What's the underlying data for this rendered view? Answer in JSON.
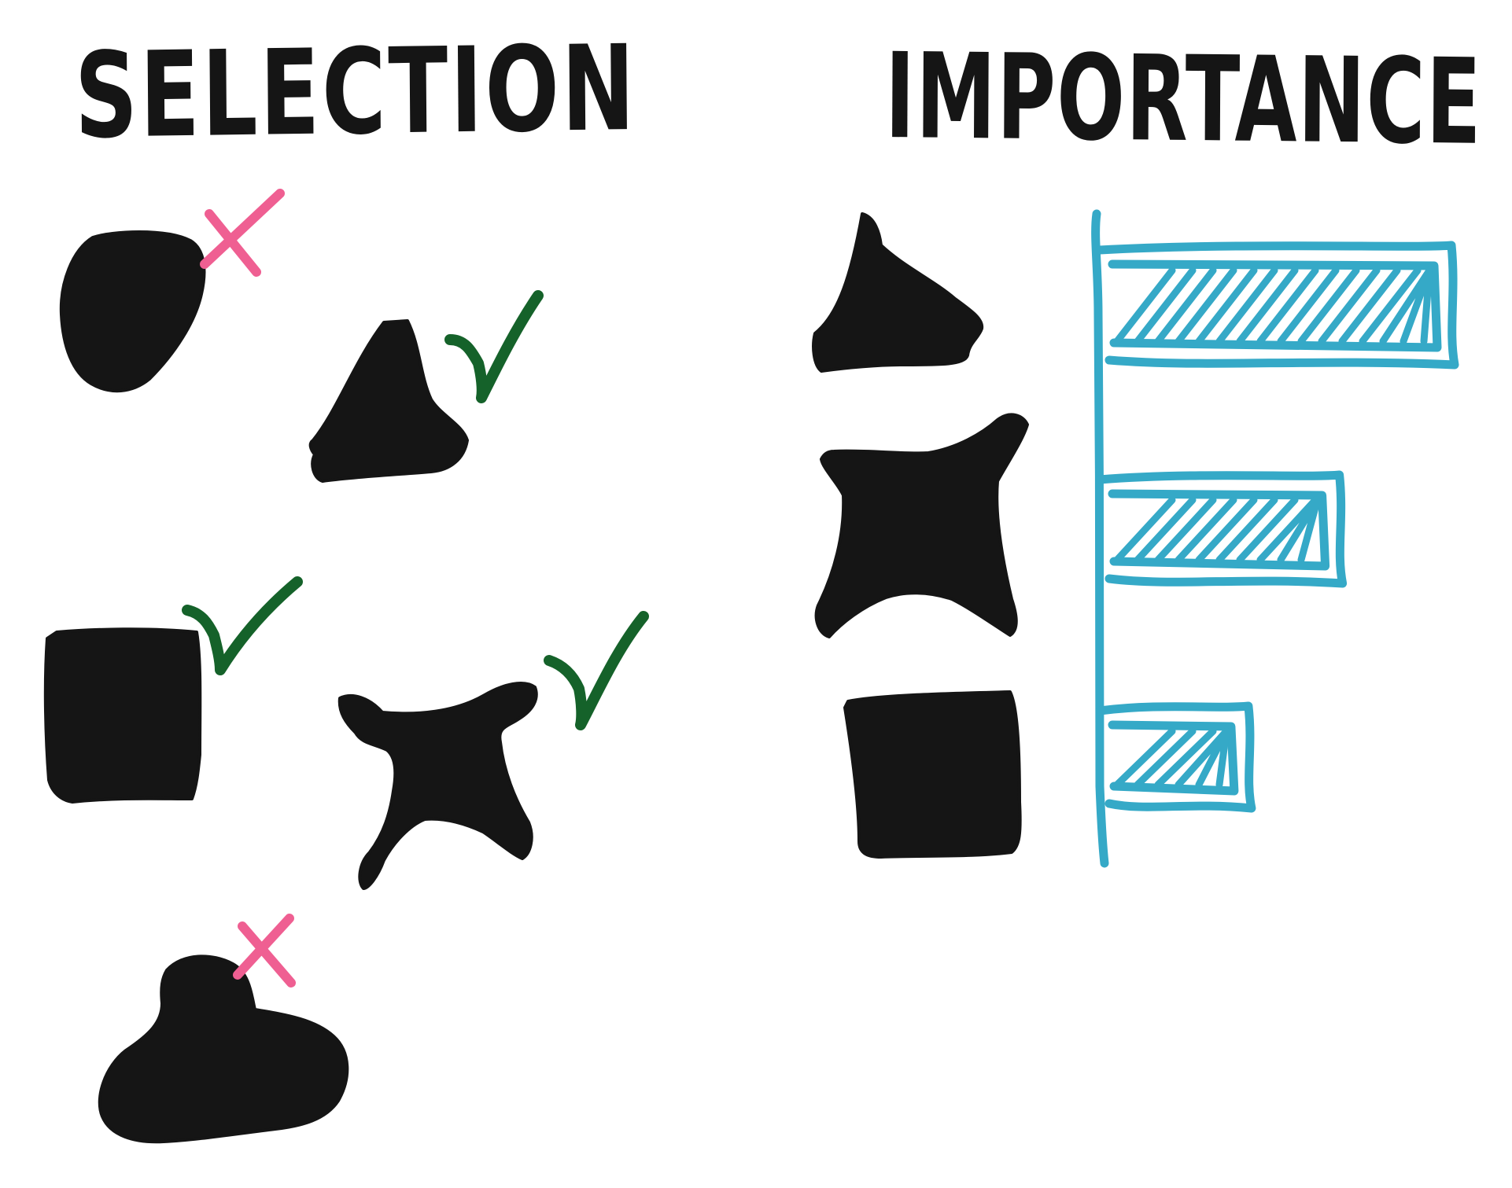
{
  "titles": {
    "selection": "SELECTION",
    "importance": "IMPORTANCE"
  },
  "colors": {
    "shape": "#151515",
    "check": "#15622a",
    "cross": "#ef5f92",
    "bar": "#35a9c7",
    "background": "#ffffff"
  },
  "selection": {
    "items": [
      {
        "shape": "blob-circle",
        "selected": false
      },
      {
        "shape": "triangle",
        "selected": true
      },
      {
        "shape": "square",
        "selected": true
      },
      {
        "shape": "four-point-star",
        "selected": true
      },
      {
        "shape": "hat-blob",
        "selected": false
      }
    ]
  },
  "importance": {
    "items": [
      {
        "shape": "triangle",
        "importance": 1.0
      },
      {
        "shape": "four-point-star",
        "importance": 0.68
      },
      {
        "shape": "square",
        "importance": 0.42
      }
    ]
  }
}
